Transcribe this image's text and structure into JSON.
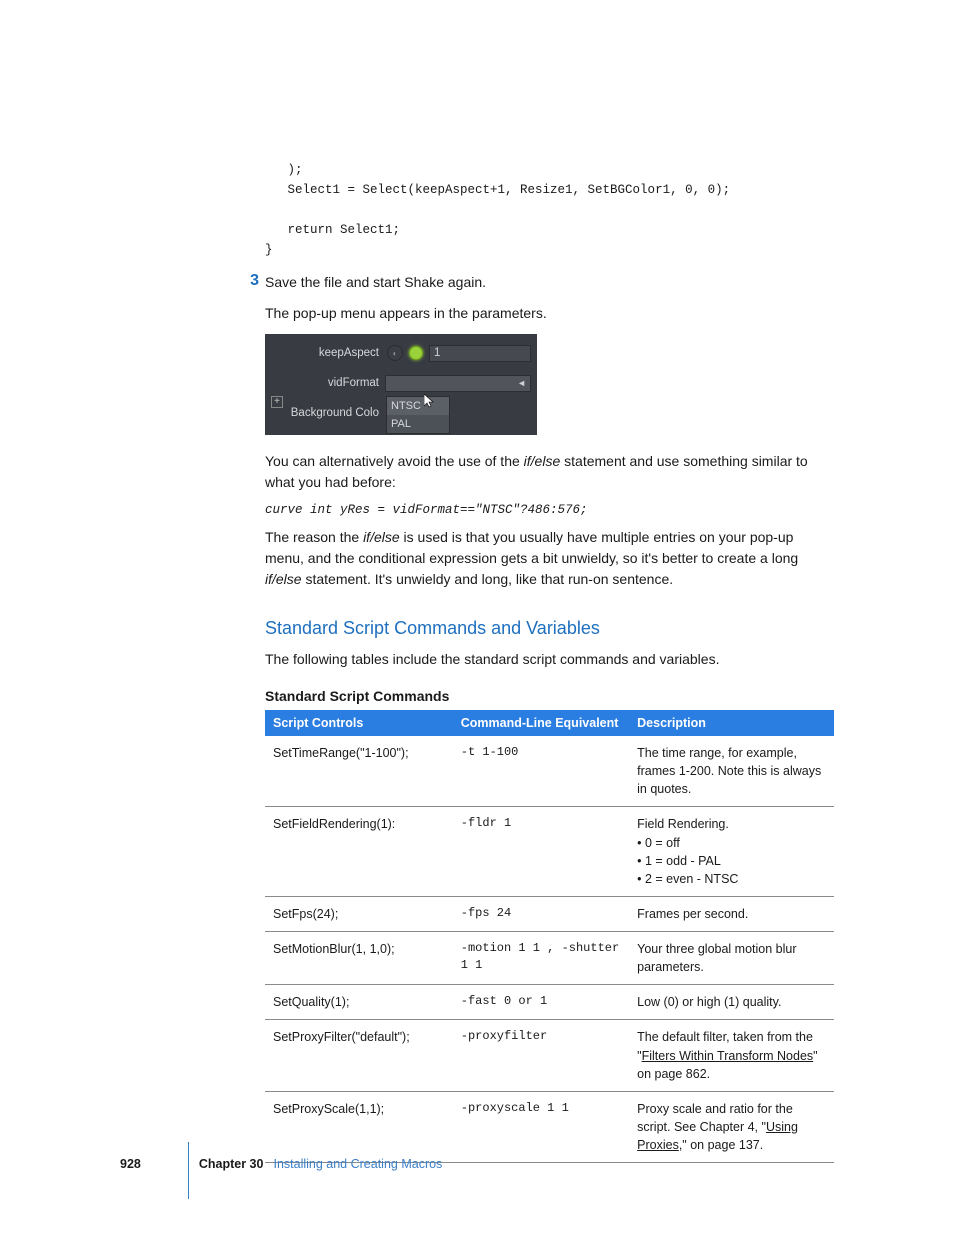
{
  "code_block_1": "   );\n   Select1 = Select(keepAspect+1, Resize1, SetBGColor1, 0, 0);\n\n   return Select1;\n}",
  "step3": {
    "num": "3",
    "text": "Save the file and start Shake again."
  },
  "para1": "The pop-up menu appears in the parameters.",
  "screenshot": {
    "row1_label": "keepAspect",
    "row1_value": "1",
    "row2_label": "vidFormat",
    "row3_label": "Background Colo",
    "popup_opt1": "NTSC",
    "popup_opt2": "PAL"
  },
  "para2_a": "You can alternatively avoid the use of the ",
  "para2_i": "if/else",
  "para2_b": " statement and use something similar to what you had before:",
  "code_line": "curve int yRes = vidFormat==\"NTSC\"?486:576;",
  "para3_a": "The reason the ",
  "para3_i1": "if/else",
  "para3_b": " is used is that you usually have multiple entries on your pop-up menu, and the conditional expression gets a bit unwieldy, so it's better to create a long ",
  "para3_i2": "if/else",
  "para3_c": " statement. It's unwieldy and long, like that run-on sentence.",
  "h2": "Standard Script Commands and Variables",
  "para4": "The following tables include the standard script commands and variables.",
  "h3": "Standard Script Commands",
  "table": {
    "head": {
      "c1": "Script Controls",
      "c2": "Command-Line Equivalent",
      "c3": "Description"
    },
    "rows": [
      {
        "c1": "SetTimeRange(\"1-100\");",
        "c2": "-t 1-100",
        "c3": "The time range, for example, frames 1-200. Note this is always in quotes."
      },
      {
        "c1": "SetFieldRendering(1):",
        "c2": "-fldr 1",
        "c3": "Field Rendering.",
        "bullets": [
          "0 = off",
          "1 = odd - PAL",
          "2 = even - NTSC"
        ]
      },
      {
        "c1": "SetFps(24);",
        "c2": "-fps 24",
        "c3": "Frames per second."
      },
      {
        "c1": "SetMotionBlur(1, 1,0);",
        "c2": "-motion 1 1 , -shutter 1 1",
        "c3": "Your three global motion blur parameters."
      },
      {
        "c1": "SetQuality(1);",
        "c2": "-fast 0 or 1",
        "c3": "Low (0) or high (1) quality."
      },
      {
        "c1": "SetProxyFilter(\"default\");",
        "c2": "-proxyfilter",
        "c3_a": "The default filter, taken from the \"",
        "c3_link": "Filters Within Transform Nodes",
        "c3_b": "\" on page 862."
      },
      {
        "c1": "SetProxyScale(1,1);",
        "c2": "-proxyscale 1 1",
        "c3_a": "Proxy scale and ratio for the script. See Chapter 4, \"",
        "c3_link": "Using Proxies",
        "c3_b": ",\" on page 137."
      }
    ]
  },
  "footer": {
    "page": "928",
    "chapter": "Chapter 30",
    "title": "Installing and Creating Macros"
  }
}
